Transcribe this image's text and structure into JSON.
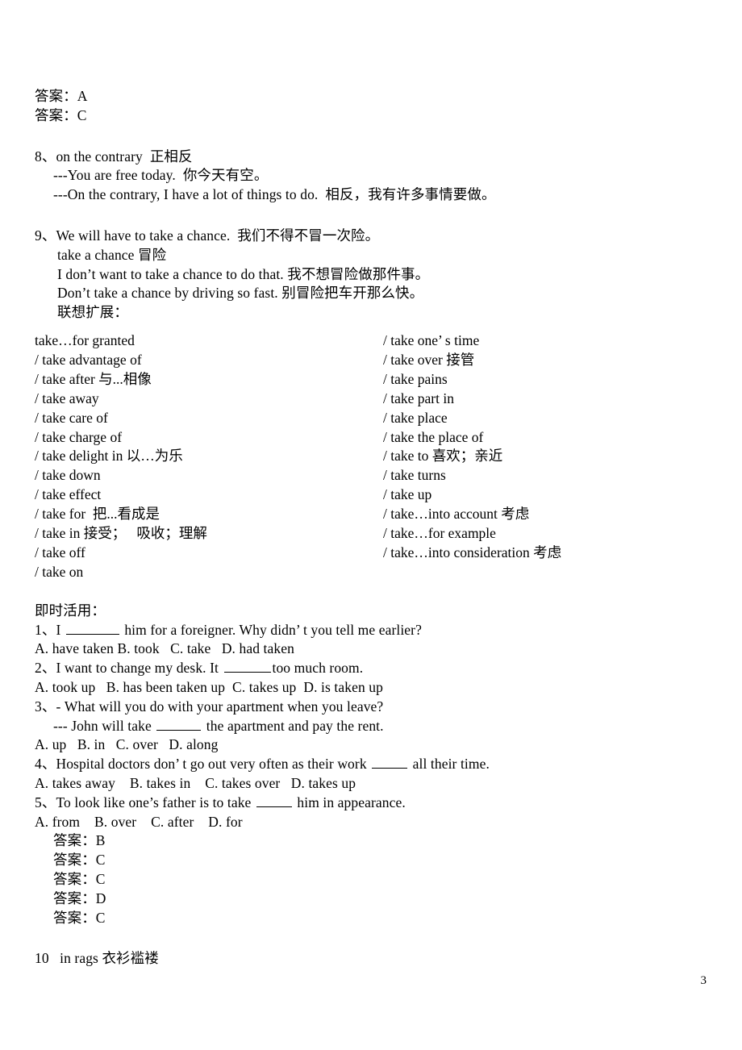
{
  "document": {
    "page_number": "3",
    "answers_top": [
      "答案：A",
      "答案：C"
    ],
    "entry_8": {
      "heading": "8、on the contrary  正相反",
      "lines": [
        "---You are free today.  你今天有空。",
        "---On the contrary, I have a lot of things to do.  相反，我有许多事情要做。"
      ]
    },
    "entry_9": {
      "heading": "9、We will have to take a chance.  我们不得不冒一次险。",
      "lines": [
        "take a chance 冒险",
        "I don’t want to take a chance to do that. 我不想冒险做那件事。",
        "Don’t take a chance by driving so fast. 别冒险把车开那么快。"
      ],
      "expansion_label": "联想扩展：",
      "phrases_left": [
        "take…for granted",
        "/ take advantage of",
        "/ take after 与...相像",
        "/ take away",
        "/ take care of",
        "/ take charge of",
        "/ take delight in 以…为乐",
        "/ take down",
        "/ take effect",
        "/ take for  把...看成是",
        "/ take in 接受；   吸收；理解",
        "/ take off",
        "/ take on"
      ],
      "phrases_right": [
        "/ take one’ s time",
        "/ take over 接管",
        "/ take pains",
        "/ take part in",
        "/ take place",
        "/ take the place of",
        "/ take to 喜欢；亲近",
        "/ take turns",
        "/ take up",
        "/ take…into account 考虑",
        "/ take…for example",
        "/ take…into consideration 考虑"
      ]
    },
    "practice": {
      "label": "即时活用：",
      "questions": [
        {
          "stem_before": "1、I ",
          "blank": "blank-w1",
          "stem_after": " him for a foreigner. Why didn’ t you tell me earlier?",
          "options": "A. have taken B. took   C. take   D. had taken"
        },
        {
          "stem_before": "2、I want to change my desk. It ",
          "blank": "blank-w2",
          "stem_after": "too much room.",
          "options": "A. took up   B. has been taken up  C. takes up  D. is taken up"
        },
        {
          "stem_before": "3、- What will you do with your apartment when you leave?",
          "sub_line_before": "--- John will take ",
          "blank": "blank-w3",
          "sub_line_after": " the apartment and pay the rent.",
          "options": "A. up   B. in   C. over   D. along"
        },
        {
          "stem_before": "4、Hospital doctors don’ t go out very often as their work ",
          "blank": "blank-w4",
          "stem_after": " all their time.",
          "options": "A. takes away    B. takes in    C. takes over   D. takes up"
        },
        {
          "stem_before": "5、To look like one’s father is to take ",
          "blank": "blank-w5",
          "stem_after": " him in appearance.",
          "options": "A. from    B. over    C. after    D. for"
        }
      ],
      "answers": [
        "答案：B",
        "答案：C",
        "答案：C",
        "答案：D",
        "答案：C"
      ]
    },
    "entry_10": "10   in rags 衣衫褴褛"
  }
}
